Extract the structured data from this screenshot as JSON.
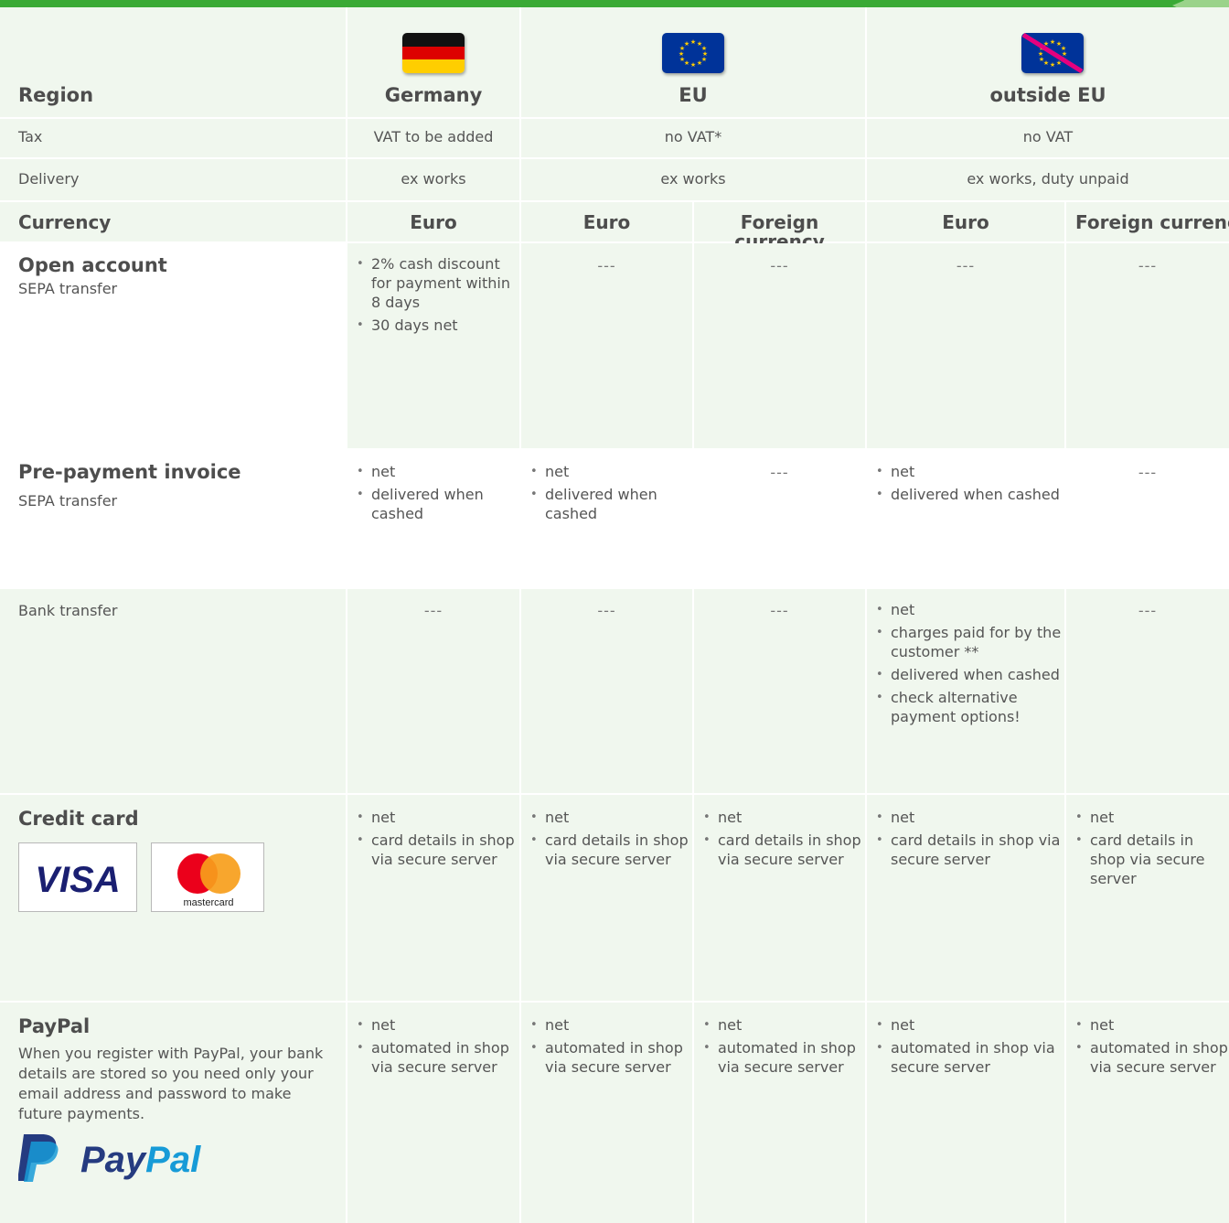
{
  "header": {
    "region_label": "Region",
    "regions": [
      "Germany",
      "EU",
      "outside EU"
    ]
  },
  "tax": {
    "label": "Tax",
    "germany": "VAT to be added",
    "eu": "no VAT*",
    "outside": "no VAT"
  },
  "delivery": {
    "label": "Delivery",
    "germany": "ex works",
    "eu": "ex works",
    "outside": "ex works, duty unpaid"
  },
  "currency": {
    "label": "Currency",
    "cols": [
      "Euro",
      "Euro",
      "Foreign currency",
      "Euro",
      "Foreign currency"
    ]
  },
  "rows": {
    "open_account": {
      "title": "Open account",
      "subtitle": "SEPA transfer",
      "germany": [
        "2% cash discount for payment within 8 days",
        "30 days net"
      ],
      "dash": "---"
    },
    "prepayment": {
      "title": "Pre-payment invoice",
      "subtitle": "SEPA transfer",
      "germany": [
        "net",
        "delivered when cashed"
      ],
      "eu_euro": [
        "net",
        "delivered when cashed"
      ],
      "outside_euro": [
        "net",
        "delivered when cashed"
      ],
      "dash": "---"
    },
    "bank_transfer": {
      "label": "Bank transfer",
      "outside_euro": [
        "net",
        "charges paid for by the customer **",
        "delivered when cashed",
        "check alternative payment options!"
      ],
      "dash": "---"
    },
    "credit_card": {
      "title": "Credit card",
      "bullets": [
        "net",
        "card details in shop via secure server"
      ],
      "visa_text": "VISA",
      "mastercard_text": "mastercard"
    },
    "paypal": {
      "title": "PayPal",
      "description": "When you register with PayPal, your bank details are stored so you need only your email address and password to make future payments.",
      "bullets": [
        "net",
        "automated in shop via secure server"
      ],
      "logo_text_1": "Pay",
      "logo_text_2": "Pal"
    }
  },
  "colors": {
    "green_bar": "#3aaa35",
    "row_tint": "#f0f7ee",
    "paypal_dark": "#253b80",
    "paypal_light": "#179bd7",
    "visa_blue": "#1a1f71",
    "mc_red": "#eb001b",
    "mc_orange": "#f79e1b"
  }
}
